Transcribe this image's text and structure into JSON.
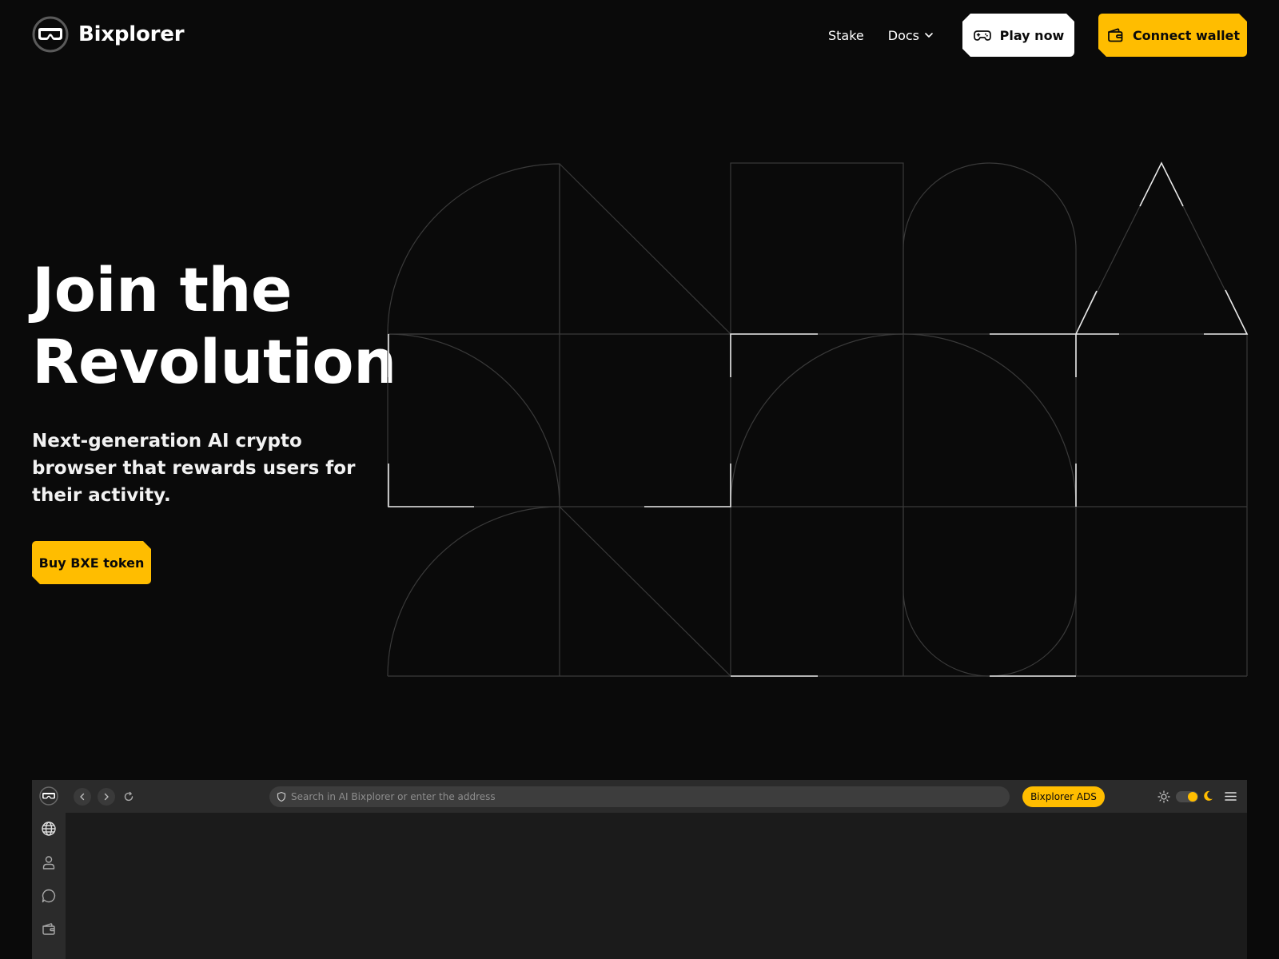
{
  "brand": {
    "name": "Bixplorer",
    "logo_icon": "vr-headset-icon"
  },
  "nav": {
    "stake_label": "Stake",
    "docs_label": "Docs",
    "play_label": "Play now",
    "connect_label": "Connect wallet"
  },
  "hero": {
    "title_line1": "Join the",
    "title_line2": "Revolution",
    "subtitle": "Next-generation AI crypto browser that rewards users for their activity.",
    "cta_label": "Buy BXE token"
  },
  "browser": {
    "search_placeholder": "Search in AI Bixplorer or enter the address",
    "ads_label": "Bixplorer ADS",
    "theme": "dark",
    "sidebar_icons": [
      "globe-icon",
      "user-icon",
      "chat-icon",
      "wallet-icon"
    ]
  },
  "colors": {
    "background": "#0a0a0a",
    "accent": "#ffbd00",
    "text": "#ffffff",
    "pattern_line": "#3a3a3a",
    "pattern_highlight": "#e8e8e8"
  }
}
